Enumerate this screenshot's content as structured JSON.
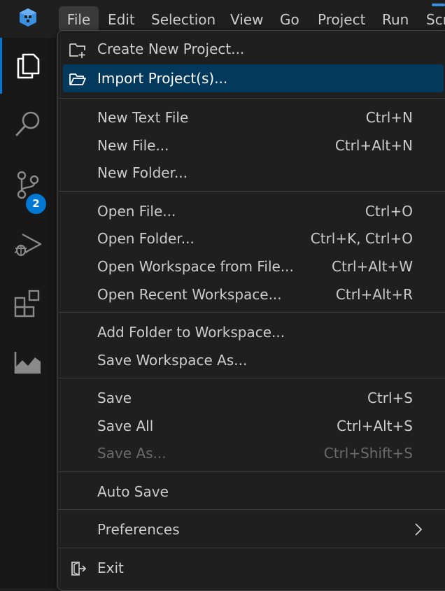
{
  "menubar": {
    "logo": "cube-logo-icon",
    "items": [
      "File",
      "Edit",
      "Selection",
      "View",
      "Go",
      "Project",
      "Run",
      "Scr"
    ]
  },
  "activitybar": {
    "items": [
      {
        "name": "explorer",
        "icon": "files-icon",
        "active": true
      },
      {
        "name": "search",
        "icon": "search-icon"
      },
      {
        "name": "source-control",
        "icon": "source-control-icon",
        "badge": "2"
      },
      {
        "name": "run-debug",
        "icon": "run-debug-icon"
      },
      {
        "name": "extensions",
        "icon": "extensions-icon"
      },
      {
        "name": "analytics",
        "icon": "chart-icon"
      }
    ]
  },
  "menu": {
    "create_project": {
      "label": "Create New Project..."
    },
    "import_project": {
      "label": "Import Project(s)..."
    },
    "new_text_file": {
      "label": "New Text File",
      "shortcut": "Ctrl+N"
    },
    "new_file": {
      "label": "New File...",
      "shortcut": "Ctrl+Alt+N"
    },
    "new_folder": {
      "label": "New Folder..."
    },
    "open_file": {
      "label": "Open File...",
      "shortcut": "Ctrl+O"
    },
    "open_folder": {
      "label": "Open Folder...",
      "shortcut": "Ctrl+K, Ctrl+O"
    },
    "open_workspace": {
      "label": "Open Workspace from File...",
      "shortcut": "Ctrl+Alt+W"
    },
    "open_recent": {
      "label": "Open Recent Workspace...",
      "shortcut": "Ctrl+Alt+R"
    },
    "add_folder": {
      "label": "Add Folder to Workspace..."
    },
    "save_workspace_as": {
      "label": "Save Workspace As..."
    },
    "save": {
      "label": "Save",
      "shortcut": "Ctrl+S"
    },
    "save_all": {
      "label": "Save All",
      "shortcut": "Ctrl+Alt+S"
    },
    "save_as": {
      "label": "Save As...",
      "shortcut": "Ctrl+Shift+S",
      "disabled": true
    },
    "auto_save": {
      "label": "Auto Save"
    },
    "preferences": {
      "label": "Preferences"
    },
    "exit": {
      "label": "Exit"
    }
  },
  "colors": {
    "accent": "#0078d4",
    "highlight": "#04395e",
    "background": "#1f1f1f"
  }
}
